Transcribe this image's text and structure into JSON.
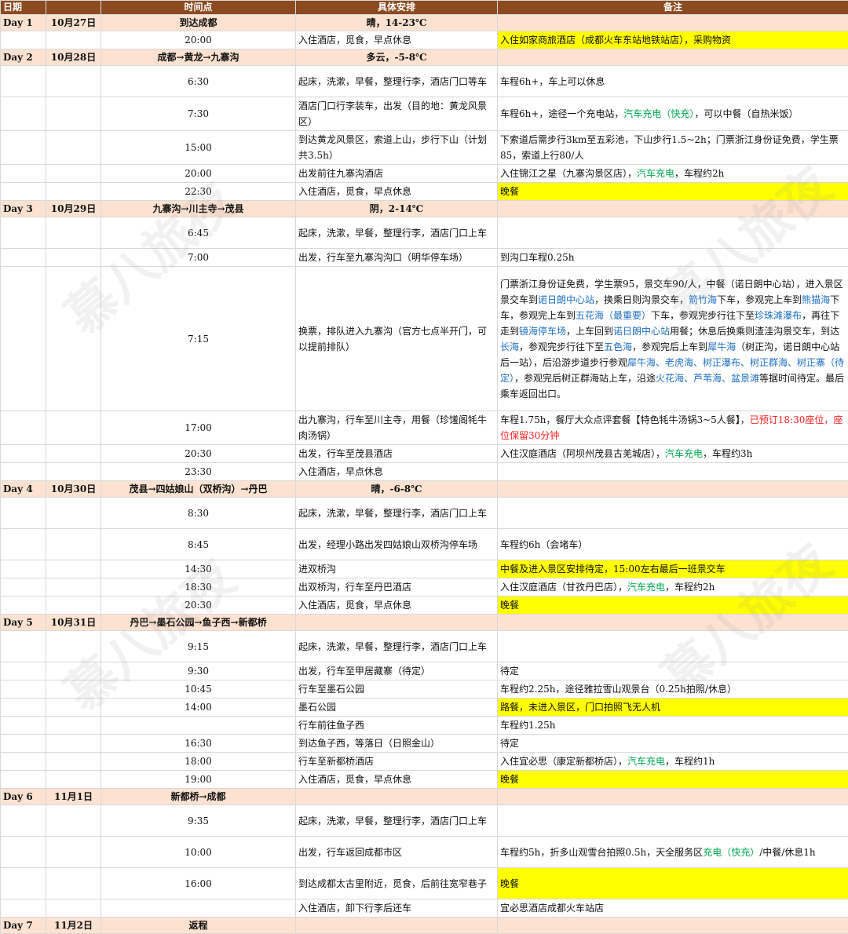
{
  "header": {
    "day": "日期",
    "time": "时间点",
    "activity": "具体安排",
    "note": "备注"
  },
  "colors": {
    "header_bg": "#8b4a1f",
    "day_bg": "#fde2d2",
    "highlight": "#ffff00",
    "green": "#00a651",
    "blue": "#1f6fc1",
    "red": "#ff1f1f"
  },
  "watermark": "慕八旅夜",
  "days": [
    {
      "day": "Day 1",
      "date": "10月27日",
      "route": "到达成都",
      "weather": "晴，14-23℃",
      "rows": [
        {
          "time": "20:00",
          "activity": "入住酒店，觅食，早点休息",
          "note": "入住如家商旅酒店（成都火车东站地铁站店），采购物资",
          "yellow": true
        }
      ]
    },
    {
      "day": "Day 2",
      "date": "10月28日",
      "route": "成都→黄龙→九寨沟",
      "weather": "多云，-5-8℃",
      "rows": [
        {
          "time": "6:30",
          "activity": "起床，洗漱，早餐，整理行李，酒店门口等车",
          "note": "车程6h+，车上可以休息"
        },
        {
          "time": "7:30",
          "activity": "酒店门口行李装车，出发（目的地：黄龙风景区）",
          "note_parts": [
            [
              "车程6h+，途径一个充电站，",
              ""
            ],
            [
              "汽车充电（快充）",
              "green"
            ],
            [
              "，可以中餐（自热米饭）",
              ""
            ]
          ]
        },
        {
          "time": "15:00",
          "activity": "到达黄龙风景区，索道上山，步行下山（计划共3.5h）",
          "note": "下索道后需步行3km至五彩池，下山步行1.5~2h；门票浙江身份证免费，学生票85，索道上行80/人"
        },
        {
          "time": "20:00",
          "activity": "出发前往九寨沟酒店",
          "note_parts": [
            [
              "入住锦江之星（九寨沟景区店），",
              ""
            ],
            [
              "汽车充电",
              "green"
            ],
            [
              "，车程约2h",
              ""
            ]
          ]
        },
        {
          "time": "22:30",
          "activity": "入住酒店，觅食，早点休息",
          "note": "晚餐",
          "yellow": true
        }
      ]
    },
    {
      "day": "Day 3",
      "date": "10月29日",
      "route": "九寨沟→川主寺→茂县",
      "weather": "阴，2-14℃",
      "rows": [
        {
          "time": "6:45",
          "activity": "起床，洗漱，早餐，整理行李，酒店门口上车",
          "note": ""
        },
        {
          "time": "7:00",
          "activity": "出发，行车至九寨沟沟口（明华停车场）",
          "note": "到沟口车程0.25h"
        },
        {
          "time": "7:15",
          "activity": "换票，排队进入九寨沟（官方七点半开门，可以提前排队）",
          "note_parts": [
            [
              "门票浙江身份证免费，学生票95，景交车90/人，中餐（诺日朗中心站），进入景区景交车到",
              ""
            ],
            [
              "诺日朗中心站",
              "blue"
            ],
            [
              "，换乘日则沟景交车，",
              ""
            ],
            [
              "箭竹海",
              "blue"
            ],
            [
              "下车，参观完上车到",
              ""
            ],
            [
              "熊猫海",
              "blue"
            ],
            [
              "下车，参观完上车到",
              ""
            ],
            [
              "五花海（最重要）",
              "blue"
            ],
            [
              "下车，参观完步行往下至",
              ""
            ],
            [
              "珍珠滩瀑布",
              "blue"
            ],
            [
              "，再往下走到",
              ""
            ],
            [
              "镜海停车场",
              "blue"
            ],
            [
              "，上车回到",
              ""
            ],
            [
              "诺日朗中心站",
              "blue"
            ],
            [
              "用餐；休息后换乘则渣洼沟景交车，到达",
              ""
            ],
            [
              "长海",
              "blue"
            ],
            [
              "，参观完步行往下至",
              ""
            ],
            [
              "五色海",
              "blue"
            ],
            [
              "，参观完后上车到",
              ""
            ],
            [
              "犀牛海",
              "blue"
            ],
            [
              "（树正沟，诺日朗中心站后一站），后沿游步道步行参观",
              ""
            ],
            [
              "犀牛海、老虎海、树正瀑布、树正群海、树正寨（待定）",
              "blue"
            ],
            [
              "，参观完后树正群海站上车，沿途",
              ""
            ],
            [
              "火花海、芦苇海、盆景滩",
              "blue"
            ],
            [
              "等据时间待定。最后乘车返回出口。",
              ""
            ]
          ]
        },
        {
          "time": "17:00",
          "activity": "出九寨沟，行车至川主寺，用餐（珍馐阁牦牛肉汤锅）",
          "note_parts": [
            [
              "车程1.75h，餐厅大众点评套餐【特色牦牛汤锅3~5人餐】，",
              ""
            ],
            [
              "已预订18:30座位，座位保留30分钟",
              "red"
            ]
          ]
        },
        {
          "time": "20:30",
          "activity": "出发，行车至茂县酒店",
          "note_parts": [
            [
              "入住汉庭酒店（阿坝州茂县古羌城店），",
              ""
            ],
            [
              "汽车充电",
              "green"
            ],
            [
              "，车程约3h",
              ""
            ]
          ]
        },
        {
          "time": "23:30",
          "activity": "入住酒店，早点休息",
          "note": ""
        }
      ]
    },
    {
      "day": "Day 4",
      "date": "10月30日",
      "route": "茂县→四姑娘山（双桥沟）→丹巴",
      "weather": "晴，-6-8℃",
      "rows": [
        {
          "time": "8:30",
          "activity": "起床，洗漱，早餐，整理行李，酒店门口上车",
          "note": ""
        },
        {
          "time": "8:45",
          "activity": "出发，经理小路出发四姑娘山双桥沟停车场",
          "note": "车程约6h（会堵车）"
        },
        {
          "time": "14:30",
          "activity": "进双桥沟",
          "note": "中餐及进入景区安排待定，15:00左右最后一班景交车",
          "yellow": true
        },
        {
          "time": "18:30",
          "activity": "出双桥沟，行车至丹巴酒店",
          "note_parts": [
            [
              "入住汉庭酒店（甘孜丹巴店），",
              ""
            ],
            [
              "汽车充电",
              "green"
            ],
            [
              "，车程约2h",
              ""
            ]
          ]
        },
        {
          "time": "20:30",
          "activity": "入住酒店，觅食，早点休息",
          "note": "晚餐",
          "yellow": true
        }
      ]
    },
    {
      "day": "Day 5",
      "date": "10月31日",
      "route": "丹巴→墨石公园→鱼子西→新都桥",
      "weather": "",
      "rows": [
        {
          "time": "9:15",
          "activity": "起床，洗漱，早餐，整理行李，酒店门口上车",
          "note": ""
        },
        {
          "time": "9:30",
          "activity": "出发，行车至甲居藏寨（待定）",
          "note": "待定"
        },
        {
          "time": "10:45",
          "activity": "行车至墨石公园",
          "note": "车程约2.25h，途径雅拉雪山观景台（0.25h拍照/休息）"
        },
        {
          "time": "14:00",
          "activity": "墨石公园",
          "note": "路餐，未进入景区，门口拍照飞无人机",
          "yellow": true
        },
        {
          "time": "",
          "activity": "行车前往鱼子西",
          "note": "车程约1.25h"
        },
        {
          "time": "16:30",
          "activity": "到达鱼子西，等落日（日照金山）",
          "note": "待定"
        },
        {
          "time": "18:00",
          "activity": "行车至新都桥酒店",
          "note_parts": [
            [
              "入住宜必思（康定新都桥店），",
              ""
            ],
            [
              "汽车充电",
              "green"
            ],
            [
              "，车程约1h",
              ""
            ]
          ]
        },
        {
          "time": "19:00",
          "activity": "入住酒店，觅食，早点休息",
          "note": "晚餐",
          "yellow": true
        }
      ]
    },
    {
      "day": "Day 6",
      "date": "11月1日",
      "route": "新都桥→成都",
      "weather": "",
      "rows": [
        {
          "time": "9:35",
          "activity": "起床，洗漱，早餐，整理行李，酒店门口上车",
          "note": ""
        },
        {
          "time": "10:00",
          "activity": "出发，行车返回成都市区",
          "note_parts": [
            [
              "车程约5h，折多山观雪台拍照0.5h，天全服务区",
              ""
            ],
            [
              "充电（快充）",
              "green"
            ],
            [
              "/中餐/休息1h",
              ""
            ]
          ]
        },
        {
          "time": "16:00",
          "activity": "到达成都太古里附近，觅食，后前往宽窄巷子",
          "note": "晚餐",
          "yellow": true
        },
        {
          "time": "",
          "activity": "入住酒店，卸下行李后还车",
          "note": "宜必思酒店成都火车站店"
        }
      ]
    },
    {
      "day": "Day 7",
      "date": "11月2日",
      "route": "返程",
      "weather": "",
      "rows": []
    }
  ]
}
